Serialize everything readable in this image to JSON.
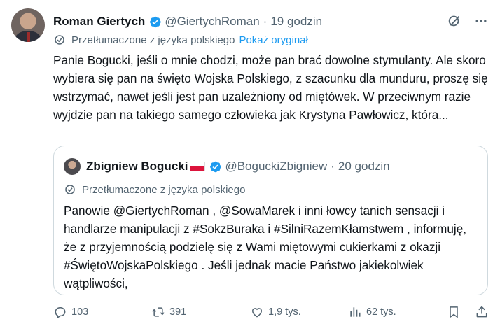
{
  "author": {
    "name": "Roman Giertych",
    "handle": "@GiertychRoman",
    "separator": "·",
    "time": "19 godzin"
  },
  "translation": {
    "label": "Przetłumaczone z języka polskiego",
    "show_original": "Pokaż oryginał"
  },
  "tweet_text": "Panie Bogucki, jeśli o mnie chodzi, może pan brać dowolne stymulanty. Ale skoro wybiera się pan na święto Wojska Polskiego, z szacunku dla munduru, proszę się wstrzymać, nawet jeśli jest pan uzależniony od miętówek. W przeciwnym razie wyjdzie pan na takiego samego człowieka jak Krystyna Pawłowicz, która...",
  "quote": {
    "name": "Zbigniew Bogucki",
    "handle": "@BoguckiZbigniew",
    "separator": "·",
    "time": "20 godzin",
    "translation_label": "Przetłumaczone z języka polskiego",
    "text": "Panowie @GiertychRoman , @SowaMarek i inni łowcy tanich sensacji i handlarze manipulacji z #SokzBuraka i #SilniRazemKłamstwem , informuję, że z przyjemnością podzielę się z Wami miętowymi cukierkami z okazji #ŚwiętoWojskaPolskiego . Jeśli jednak macie Państwo jakiekolwiek wątpliwości,"
  },
  "actions": {
    "replies": "103",
    "reposts": "391",
    "likes": "1,9 tys.",
    "views": "62 tys."
  },
  "icons": [
    "verified-badge-icon",
    "grok-icon",
    "more-icon",
    "translate-icon",
    "reply-icon",
    "repost-icon",
    "like-icon",
    "views-icon",
    "bookmark-icon",
    "share-icon"
  ],
  "colors": {
    "text": "#0f1419",
    "secondary": "#536471",
    "link": "#1d9bf0",
    "verified": "#1d9bf0",
    "border": "#cfd9de"
  }
}
